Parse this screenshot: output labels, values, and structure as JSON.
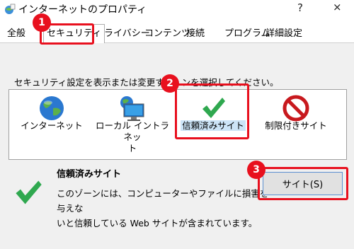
{
  "window": {
    "title": "インターネットのプロパティ",
    "help": "?",
    "close": "×"
  },
  "tabs": [
    {
      "label": "全般"
    },
    {
      "label": "セキュリティ",
      "active": true
    },
    {
      "label": "プライバシー"
    },
    {
      "label": "コンテンツ"
    },
    {
      "label": "接続"
    },
    {
      "label": "プログラム"
    },
    {
      "label": "詳細設定"
    }
  ],
  "security": {
    "instruction": "セキュリティ設定を表示または変更する　ンを選択してください。",
    "zones": [
      {
        "label": "インターネット",
        "icon": "globe-icon"
      },
      {
        "label_line1": "ローカル イントラネッ",
        "label_line2": "ト",
        "icon": "intranet-icon"
      },
      {
        "label": "信頼済みサイト",
        "icon": "green-checkmark-icon",
        "selected": true
      },
      {
        "label": "制限付きサイト",
        "icon": "restricted-icon"
      }
    ],
    "selected_zone_title": "信頼済みサイト",
    "description_line1": "このゾーンには、コンピューターやファイルに損害を与えな",
    "description_line2": "いと信頼している Web サイトが含まれています。",
    "sites_button": "サイト(S)"
  },
  "annotations": {
    "badge1": "1",
    "badge2": "2",
    "badge3": "3",
    "color": "#e8101e"
  }
}
